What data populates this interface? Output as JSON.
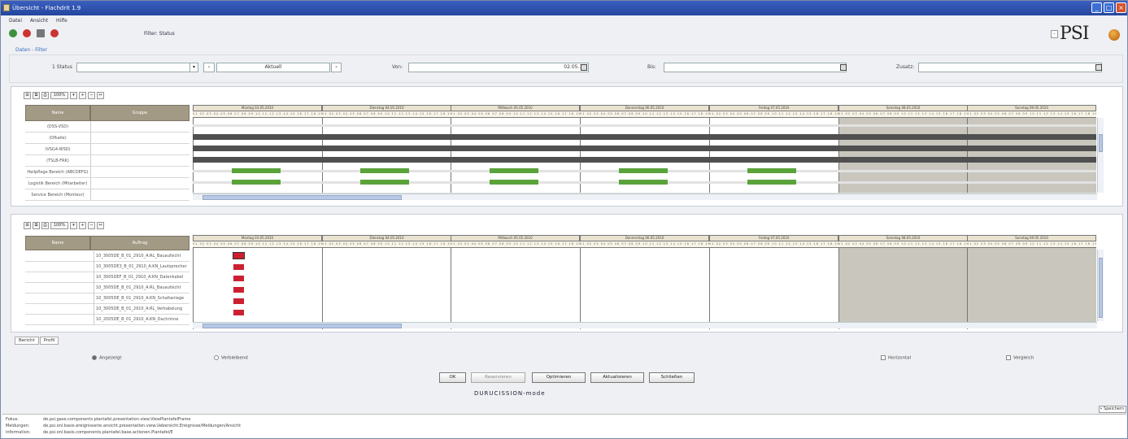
{
  "window": {
    "title": "Übersicht - Flachdrit 1.9",
    "min": "_",
    "max": "□",
    "close": "×"
  },
  "menu": [
    "Datei",
    "Ansicht",
    "Hilfe"
  ],
  "toolbar": {
    "filter_label": "Filter: Status"
  },
  "brand": {
    "logo": "PSI",
    "combo": "-"
  },
  "filter": {
    "section_label": "Daten - Filter",
    "status_label": "1 Status",
    "status_value": "",
    "mode_value": "Aktuell",
    "von_label": "Von:",
    "von_value": "02.05.10",
    "bis_label": "Bis:",
    "bis_value": "",
    "zusatz_label": "Zusatz:",
    "zusatz_value": ""
  },
  "top_panel": {
    "zoom": "100%",
    "headers": [
      "Name",
      "Gruppe"
    ],
    "rows": [
      "(DSS-VSD)",
      "(Ofkalle)",
      "(VSG4-WSD)",
      "(TSLB-FRK)",
      "Heilpflege Bereich (ABCDEFG)",
      "Logistik Bereich (Mitarbeiter)",
      "Service Bereich (Monteur)"
    ],
    "days": [
      "Montag 03.05.2010",
      "Dienstag 04.05.2010",
      "Mittwoch 05.05.2010",
      "Donnerstag 06.05.2010",
      "Freitag 07.05.2010",
      "Samstag 08.05.2010",
      "Sonntag 09.05.2010"
    ]
  },
  "bottom_panel": {
    "zoom": "100%",
    "headers": [
      "Name",
      "Auftrag"
    ],
    "rows": [
      "10_3005DE_B_01_2910_A:RL_Bauaufsicht",
      "10_3005DE3_B_01_2910_A:KN_Lautsprecher",
      "10_3005DEF_B_01_2910_A:KN_Datenkabel",
      "10_3005DE_B_01_2910_A:RL_Bauaufsicht",
      "10_3005DE_B_01_2910_A:KN_Schaltanlage",
      "10_3005DE_B_01_2910_A:RL_Verkabelung",
      "10_2005DE_B_01_2910_A:KN_Dachrinne"
    ],
    "days": [
      "Montag 03.05.2010",
      "Dienstag 04.05.2010",
      "Mittwoch 05.05.2010",
      "Donnerstag 06.05.2010",
      "Freitag 07.05.2010",
      "Samstag 08.05.2010",
      "Sonntag 09.05.2010"
    ]
  },
  "tabs": [
    "Bericht",
    "Profil"
  ],
  "options": {
    "radio1": "Angezeigt",
    "radio2": "Verbleibend",
    "check1": "Horizontal",
    "check2": "Vergleich"
  },
  "buttons": {
    "ok": "OK",
    "optimize": "Reservieren",
    "options": "Optimieren",
    "update": "Aktualisieren",
    "close": "Schließen"
  },
  "footer_brand": "DURUCISSION-mode",
  "status_combo": "• Speichern",
  "log": [
    {
      "k": "Fokus:",
      "v": "de.psi.gase.components.plantafel.presentation.view.ViewPlantafelFrame"
    },
    {
      "k": "Meldungen:",
      "v": "de.psi.onl.basis.ereignisserie.ansicht.presentation.view.Uebersicht.Ereignisse/Meldungen/Ansicht"
    },
    {
      "k": "Information:",
      "v": "de.psi.onl.basis.components.plantafel.base.actionen.Plantafel/E"
    }
  ],
  "colors": {
    "green": "#5aa33a",
    "red": "#cc2030",
    "dark": "#505050",
    "weekend": "#c9c6be"
  }
}
